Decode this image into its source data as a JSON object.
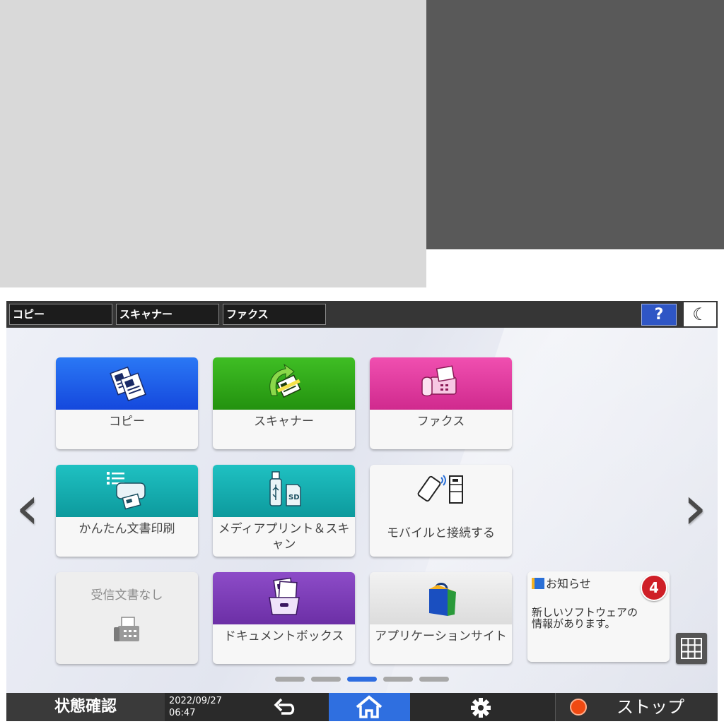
{
  "topbar": {
    "tabs": [
      "コピー",
      "スキャナー",
      "ファクス"
    ],
    "help_label": "?",
    "sleep_glyph": "☾"
  },
  "navigation": {
    "prev_glyph": "‹",
    "next_glyph": "›"
  },
  "tiles": [
    {
      "id": "copy",
      "label": "コピー",
      "color": "#1f5ef0"
    },
    {
      "id": "scanner",
      "label": "スキャナー",
      "color": "#2fa51a"
    },
    {
      "id": "fax",
      "label": "ファクス",
      "color": "#e0379e"
    },
    {
      "id": "easy-print",
      "label": "かんたん文書印刷",
      "color": "#13a6a9"
    },
    {
      "id": "media-print",
      "label": "メディアプリント＆スキャン",
      "color": "#13a6a9"
    },
    {
      "id": "mobile",
      "label": "モバイルと接続する",
      "color": "#f7f7f7"
    },
    {
      "id": "received-docs",
      "label": "受信文書なし",
      "color": "#eeeeee"
    },
    {
      "id": "document-box",
      "label": "ドキュメントボックス",
      "color": "#7c3db6"
    },
    {
      "id": "app-site",
      "label": "アプリケーションサイト",
      "color": "#e8e8e8"
    }
  ],
  "notice": {
    "title": "お知らせ",
    "count": "4",
    "message": "新しいソフトウェアの情報があります。"
  },
  "pager": {
    "pages": 5,
    "active": 3
  },
  "bottombar": {
    "status_label": "状態確認",
    "date": "2022/09/27",
    "time": "06:47",
    "back_glyph": "⮌",
    "settings_glyph": "✲",
    "stop_label": "ストップ"
  },
  "colors": {
    "home_active": "#2f6fe0",
    "stop_icon": "#f04a12",
    "badge": "#cf1f27"
  }
}
